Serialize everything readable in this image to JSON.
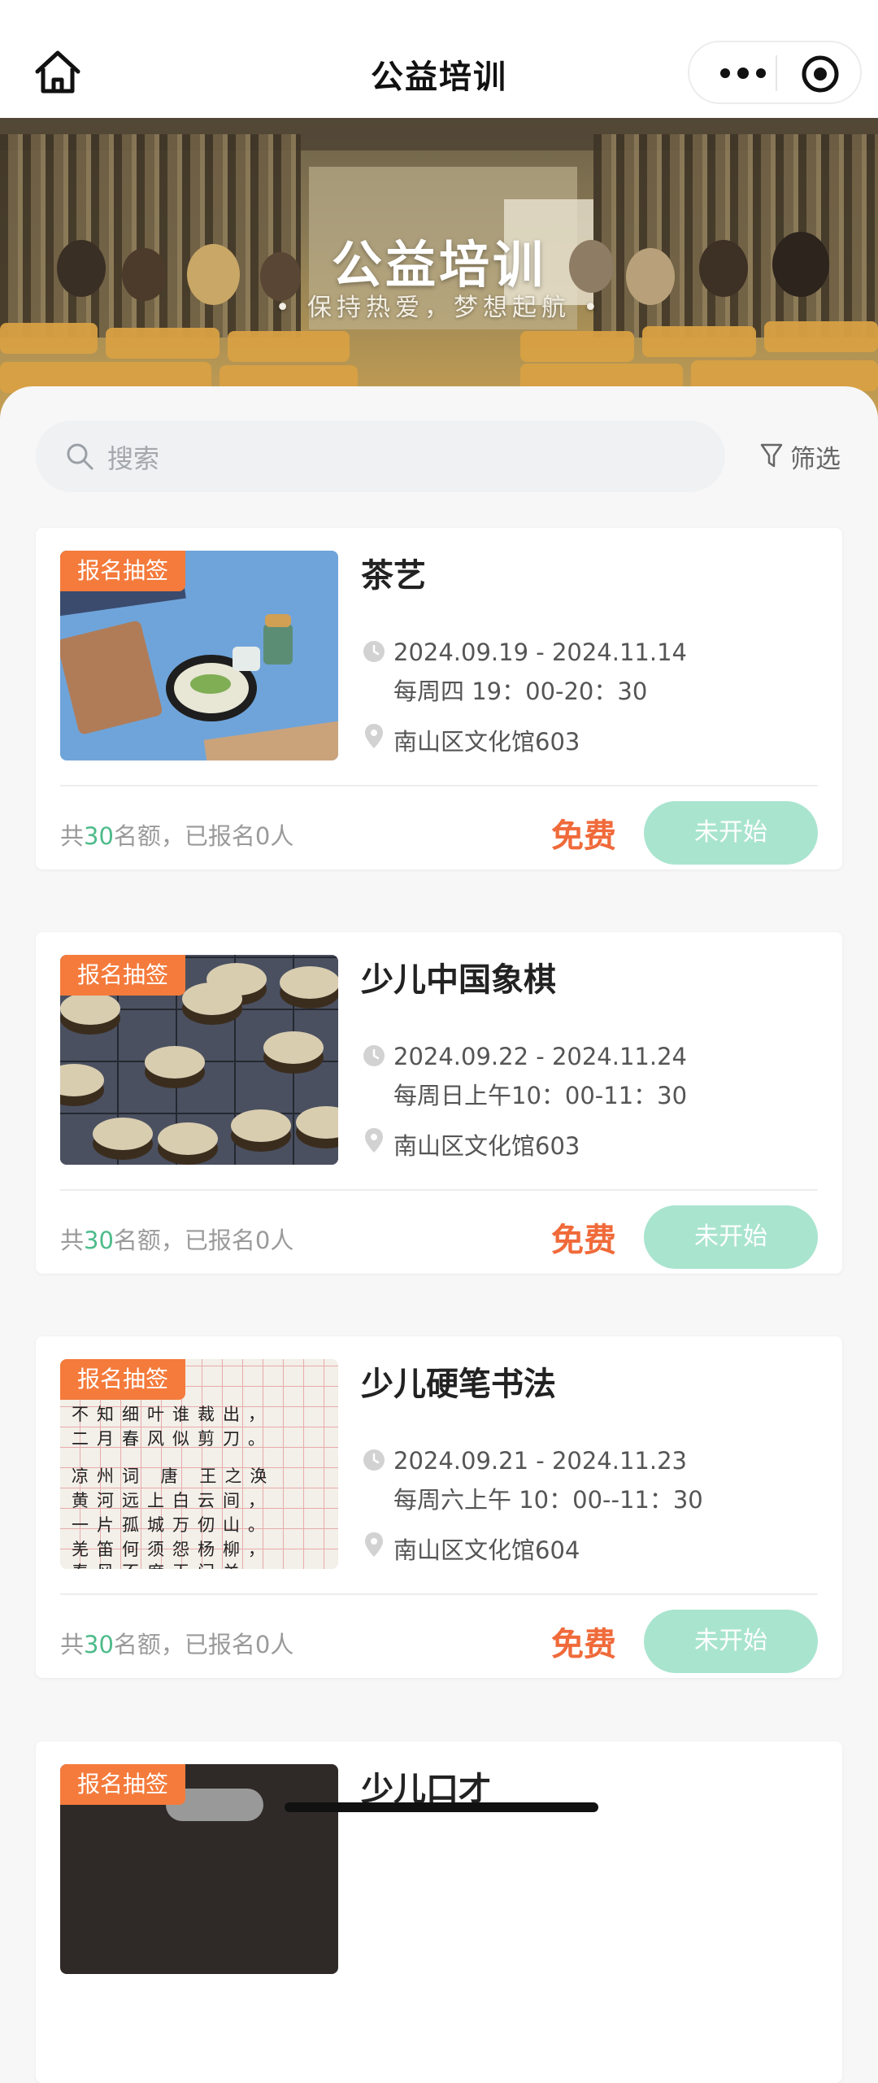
{
  "nav": {
    "title": "公益培训",
    "home_icon": "home-icon",
    "more_icon": "more-dots-icon",
    "close_icon": "target-circle-icon"
  },
  "banner": {
    "title": "公益培训",
    "subtitle": "• 保持热爱，梦想起航 •"
  },
  "search": {
    "placeholder": "搜索",
    "filter_label": "筛选"
  },
  "colors": {
    "tag": "#f47b3c",
    "price": "#f06a3a",
    "quota_number": "#4dbb8a",
    "status_button": "#a9e4cf"
  },
  "courses": [
    {
      "tag": "报名抽签",
      "title": "茶艺",
      "date": "2024.09.19 - 2024.11.14",
      "time": "每周四 19：00-20：30",
      "location": "南山区文化馆603",
      "quota_prefix": "共",
      "quota_number": "30",
      "quota_suffix": "名额，已报名0人",
      "price": "免费",
      "status": "未开始"
    },
    {
      "tag": "报名抽签",
      "title": "少儿中国象棋",
      "date": "2024.09.22 - 2024.11.24",
      "time": "每周日上午10：00-11：30",
      "location": "南山区文化馆603",
      "quota_prefix": "共",
      "quota_number": "30",
      "quota_suffix": "名额，已报名0人",
      "price": "免费",
      "status": "未开始"
    },
    {
      "tag": "报名抽签",
      "title": "少儿硬笔书法",
      "date": "2024.09.21 - 2024.11.23",
      "time": "每周六上午 10：00--11：30",
      "location": "南山区文化馆604",
      "quota_prefix": "共",
      "quota_number": "30",
      "quota_suffix": "名额，已报名0人",
      "price": "免费",
      "status": "未开始"
    },
    {
      "tag": "报名抽签",
      "title": "少儿口才"
    }
  ],
  "calligraphy_lines": [
    "不知细叶谁裁出，",
    "二月春风似剪刀。",
    "凉州词  唐  王之涣",
    "黄河远上白云间，",
    "一片孤城万仞山。",
    "羌笛何须怨杨柳，",
    "春风不度玉门关。"
  ]
}
